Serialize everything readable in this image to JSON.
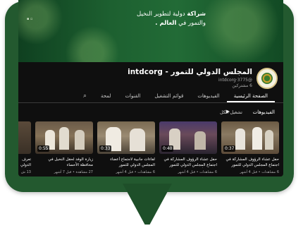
{
  "banner": {
    "line1_bold": "شراكة",
    "line1_rest": " دولية لتطوير النخيل",
    "line2_rest": "والتمور في ",
    "line2_bold": "العالم ."
  },
  "channel": {
    "name": "المجلس الدولي للتمور - intdcorg",
    "handle": "@intdcorg·3775",
    "subscribers": "6 مشتركين"
  },
  "tabs": [
    {
      "label": "الصفحة الرئيسية"
    },
    {
      "label": "الفيديوهات"
    },
    {
      "label": "قوائم التشغيل"
    },
    {
      "label": "القنوات"
    },
    {
      "label": "لمحة"
    }
  ],
  "section": {
    "title": "الفيديوهات",
    "play_all": "تشغيل الكل"
  },
  "videos": [
    {
      "duration": "0:37",
      "title": "حفل عشاء الرؤوف المشاركة في اجتماع المجلس الدولي للتمور (الجزء الثاني)",
      "meta": "6 مشاهدات • قبل 4 أشهر"
    },
    {
      "duration": "0:40",
      "title": "حفل عشاء الرؤوف المشاركة في اجتماع المجلس الدولي للتمور (الجزء الأول)",
      "meta": "6 مشاهدات • قبل 4 أشهر"
    },
    {
      "duration": "0:33",
      "title": "لقاءات جانبية لاجتماع أعضاء المجلس الدولي للتمور",
      "meta": "6 مشاهدات • قبل 4 أشهر"
    },
    {
      "duration": "0:55",
      "title": "زيارة الوفد لحقل النخيل في محافظة الأحساء",
      "meta": "27 مشاهدة • قبل 7 أشهر"
    },
    {
      "duration": "",
      "title": "تعرف الدولي",
      "meta": "13 ش"
    }
  ]
}
